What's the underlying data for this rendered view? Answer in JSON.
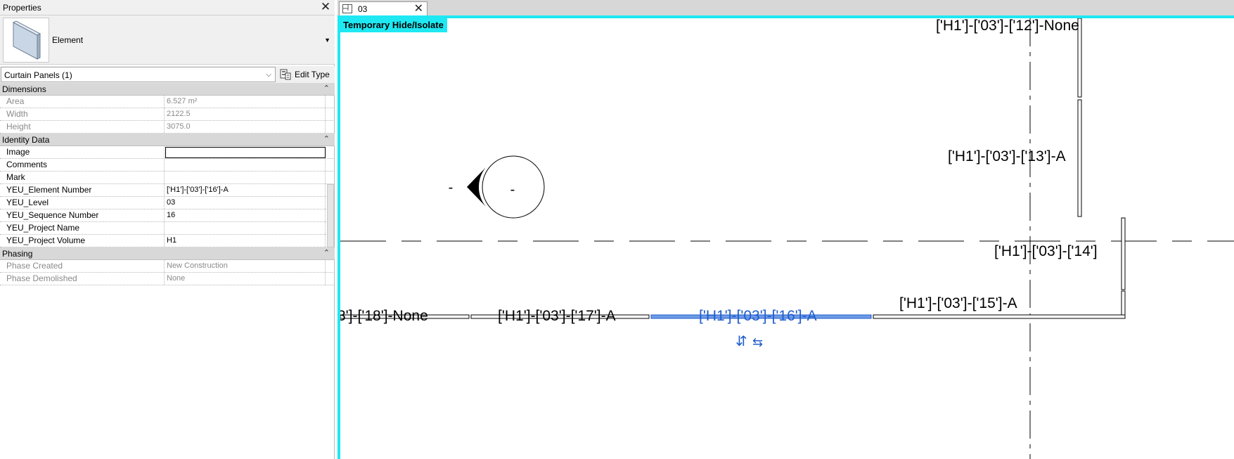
{
  "properties": {
    "title": "Properties",
    "type_name": "Element",
    "filter": "Curtain Panels (1)",
    "edit_type_label": "Edit Type",
    "groups": {
      "dimensions": "Dimensions",
      "identity": "Identity Data",
      "phasing": "Phasing"
    },
    "dimensions": {
      "area_name": "Area",
      "area_value": "6.527 m²",
      "width_name": "Width",
      "width_value": "2122.5",
      "height_name": "Height",
      "height_value": "3075.0"
    },
    "identity": {
      "image_name": "Image",
      "image_value": "",
      "comments_name": "Comments",
      "comments_value": "",
      "mark_name": "Mark",
      "mark_value": "",
      "elem_name": "YEU_Element Number",
      "elem_value": "['H1']-['03']-['16']-A",
      "level_name": "YEU_Level",
      "level_value": "03",
      "seq_name": "YEU_Sequence Number",
      "seq_value": "16",
      "projname_name": "YEU_Project Name",
      "projname_value": "",
      "projvol_name": "YEU_Project Volume",
      "projvol_value": "H1"
    },
    "phasing": {
      "created_name": "Phase Created",
      "created_value": "New Construction",
      "demolished_name": "Phase Demolished",
      "demolished_value": "None"
    }
  },
  "view": {
    "tab_label": "03",
    "hide_isolate_label": "Temporary Hide/Isolate",
    "tags": {
      "t12": "['H1']-['03']-['12']-None",
      "t13": "['H1']-['03']-['13']-A",
      "t14": "['H1']-['03']-['14']",
      "t15": "['H1']-['03']-['15']-A",
      "t16": "['H1']-['03']-['16']-A",
      "t17": "['H1']-['03']-['17']-A",
      "t18": "3']-['18']-None"
    },
    "elevation_mark": {
      "left_text": "-",
      "inner_text": "-"
    },
    "flip_controls": {
      "vertical": "⇵",
      "horizontal": "⇆"
    },
    "colors": {
      "selection": "#1f5dcc",
      "temporary_border": "#1ee8f2"
    }
  }
}
